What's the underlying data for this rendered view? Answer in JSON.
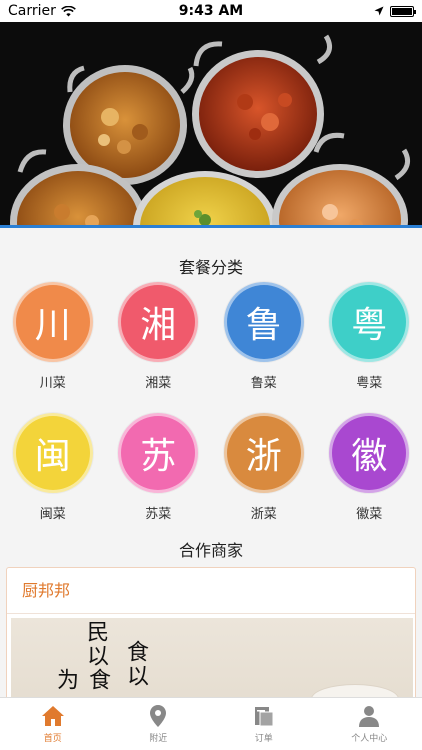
{
  "status_bar": {
    "carrier": "Carrier",
    "time": "9:43 AM"
  },
  "sections": {
    "category_title": "套餐分类",
    "partner_title": "合作商家"
  },
  "categories": [
    {
      "char": "川",
      "label": "川菜",
      "color": "#f08a4a"
    },
    {
      "char": "湘",
      "label": "湘菜",
      "color": "#f05a6c"
    },
    {
      "char": "鲁",
      "label": "鲁菜",
      "color": "#3f86d6"
    },
    {
      "char": "粤",
      "label": "粤菜",
      "color": "#3ecfc8"
    },
    {
      "char": "闽",
      "label": "闽菜",
      "color": "#f3d43a"
    },
    {
      "char": "苏",
      "label": "苏菜",
      "color": "#f26ab0"
    },
    {
      "char": "浙",
      "label": "浙菜",
      "color": "#d98a3e"
    },
    {
      "char": "徽",
      "label": "徽菜",
      "color": "#a948d0"
    }
  ],
  "partner": {
    "name": "厨邦邦",
    "calligraphy": [
      "民以",
      "食以",
      "食为"
    ]
  },
  "tabs": [
    {
      "label": "首页",
      "icon": "home-icon",
      "active": true
    },
    {
      "label": "附近",
      "icon": "location-pin-icon",
      "active": false
    },
    {
      "label": "订单",
      "icon": "orders-icon",
      "active": false
    },
    {
      "label": "个人中心",
      "icon": "user-icon",
      "active": false
    }
  ],
  "colors": {
    "accent": "#e07a2e",
    "hero_border": "#2a7fd4"
  }
}
